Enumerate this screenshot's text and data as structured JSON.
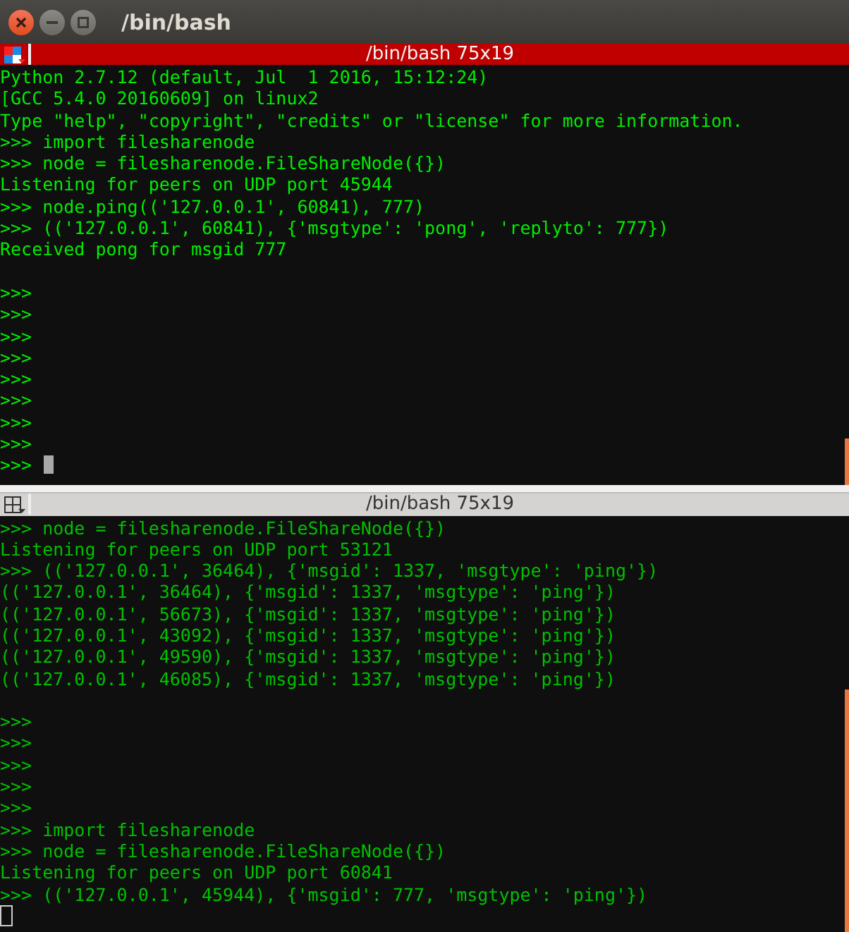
{
  "window": {
    "title": "/bin/bash"
  },
  "panes": [
    {
      "title": "/bin/bash 75x19",
      "focused": true,
      "lines": [
        {
          "kind": "text",
          "text": "Python 2.7.12 (default, Jul  1 2016, 15:12:24)"
        },
        {
          "kind": "text",
          "text": "[GCC 5.4.0 20160609] on linux2"
        },
        {
          "kind": "text",
          "text": "Type \"help\", \"copyright\", \"credits\" or \"license\" for more information."
        },
        {
          "kind": "text",
          "text": ">>> import filesharenode"
        },
        {
          "kind": "text",
          "text": ">>> node = filesharenode.FileShareNode({})"
        },
        {
          "kind": "text",
          "text": "Listening for peers on UDP port 45944"
        },
        {
          "kind": "text",
          "text": ">>> node.ping(('127.0.0.1', 60841), 777)"
        },
        {
          "kind": "text",
          "text": ">>> (('127.0.0.1', 60841), {'msgtype': 'pong', 'replyto': 777})"
        },
        {
          "kind": "text",
          "text": "Received pong for msgid 777"
        },
        {
          "kind": "blank"
        },
        {
          "kind": "text",
          "text": ">>>"
        },
        {
          "kind": "text",
          "text": ">>>"
        },
        {
          "kind": "text",
          "text": ">>>"
        },
        {
          "kind": "text",
          "text": ">>>"
        },
        {
          "kind": "text",
          "text": ">>>"
        },
        {
          "kind": "text",
          "text": ">>>"
        },
        {
          "kind": "text",
          "text": ">>>"
        },
        {
          "kind": "text",
          "text": ">>>"
        },
        {
          "kind": "text",
          "text": ">>>",
          "cursor": true
        }
      ]
    },
    {
      "title": "/bin/bash 75x19",
      "focused": false,
      "lines": [
        {
          "kind": "text",
          "text": ">>> node = filesharenode.FileShareNode({})"
        },
        {
          "kind": "text",
          "text": "Listening for peers on UDP port 53121"
        },
        {
          "kind": "text",
          "text": ">>> (('127.0.0.1', 36464), {'msgid': 1337, 'msgtype': 'ping'})"
        },
        {
          "kind": "text",
          "text": "(('127.0.0.1', 36464), {'msgid': 1337, 'msgtype': 'ping'})"
        },
        {
          "kind": "text",
          "text": "(('127.0.0.1', 56673), {'msgid': 1337, 'msgtype': 'ping'})"
        },
        {
          "kind": "text",
          "text": "(('127.0.0.1', 43092), {'msgid': 1337, 'msgtype': 'ping'})"
        },
        {
          "kind": "text",
          "text": "(('127.0.0.1', 49590), {'msgid': 1337, 'msgtype': 'ping'})"
        },
        {
          "kind": "text",
          "text": "(('127.0.0.1', 46085), {'msgid': 1337, 'msgtype': 'ping'})"
        },
        {
          "kind": "blank"
        },
        {
          "kind": "text",
          "text": ">>>"
        },
        {
          "kind": "text",
          "text": ">>>"
        },
        {
          "kind": "text",
          "text": ">>>"
        },
        {
          "kind": "text",
          "text": ">>>"
        },
        {
          "kind": "text",
          "text": ">>>"
        },
        {
          "kind": "text",
          "text": ">>> import filesharenode"
        },
        {
          "kind": "text",
          "text": ">>> node = filesharenode.FileShareNode({})"
        },
        {
          "kind": "text",
          "text": "Listening for peers on UDP port 60841"
        },
        {
          "kind": "text",
          "text": ">>> (('127.0.0.1', 45944), {'msgid': 777, 'msgtype': 'ping'})"
        },
        {
          "kind": "blank",
          "cursor": true
        }
      ]
    }
  ]
}
